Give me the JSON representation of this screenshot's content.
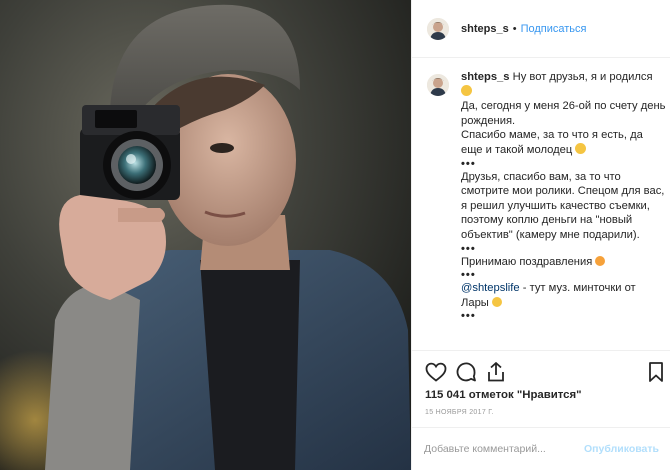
{
  "post": {
    "username": "shteps_s",
    "separator": "•",
    "follow_label": "Подписаться",
    "photo_alt": "man holding camera",
    "caption": {
      "username": "shteps_s",
      "line1": "Ну вот друзья, я и родился",
      "line2": "Да, сегодня у меня 26-ой по счету день рождения.",
      "line3": "Спасибо маме, за то что я есть, да еще и такой молодец",
      "bullet": "•••",
      "line4": "Друзья, спасибо вам, за то что смотрите мои ролики. Спецом для вас, я решил улучшить качество съемки, поэтому коплю деньги на \"новый объектив\" (камеру мне подарили).",
      "line5": "Принимаю поздравления",
      "mention": "@shtepslife",
      "line6": " - тут муз. минточки от Лары"
    },
    "icons": [
      "heart-icon",
      "comment-icon",
      "share-icon",
      "bookmark-icon"
    ],
    "likes_text": "115 041 отметок \"Нравится\"",
    "date_text": "15 ноября 2017 г.",
    "comment_placeholder": "Добавьте комментарий...",
    "publish_label": "Опубликовать",
    "colors": {
      "link": "#3897f0",
      "text": "#262626",
      "muted": "#999999",
      "publish_disabled": "#b2dffc",
      "border": "#efefef"
    }
  }
}
